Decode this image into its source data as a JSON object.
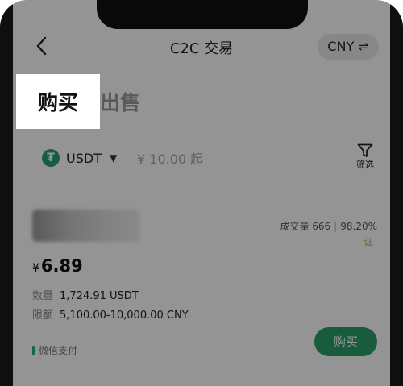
{
  "header": {
    "back_icon": "chevron-left-icon",
    "title": "C2C 交易",
    "currency": "CNY ⇌"
  },
  "tabs": {
    "buy": "购买",
    "sell": "出售"
  },
  "filter": {
    "coin_logo": "₮",
    "coin": "USDT",
    "caret": "▼",
    "amount_placeholder": "¥ 10.00 起",
    "filter_label": "筛选",
    "filter_icon": "funnel-icon"
  },
  "listing": {
    "trades_label": "成交量 666",
    "completion_rate": "98.20%",
    "verify_badge": "证",
    "price_symbol": "¥",
    "price": "6.89",
    "quantity_label": "数量",
    "quantity_value": "1,724.91 USDT",
    "limit_label": "限额",
    "limit_value": "5,100.00-10,000.00 CNY",
    "payment_method": "微信支付",
    "buy_label": "购买"
  },
  "colors": {
    "accent": "#2a9e6a",
    "usdt": "#26a17b",
    "overlay": "rgba(0,0,0,0.42)"
  }
}
